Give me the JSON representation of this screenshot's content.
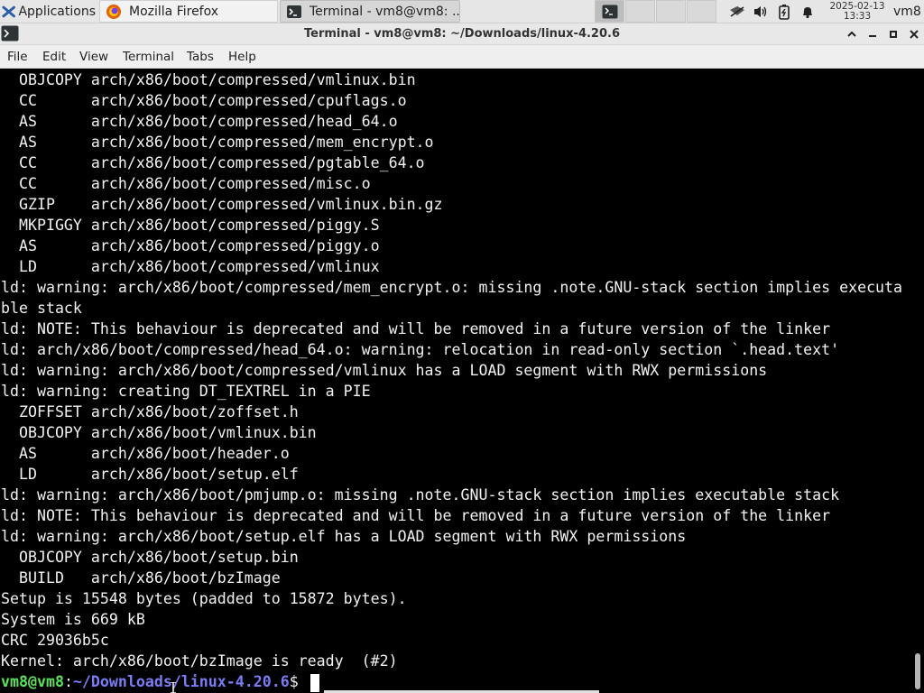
{
  "panel": {
    "applications_label": "Applications",
    "tasks": [
      {
        "label": "Mozilla Firefox",
        "icon": "firefox-icon"
      },
      {
        "label": "Terminal - vm8@vm8: ...",
        "icon": "terminal-icon"
      }
    ],
    "clock_date": "2025-02-13",
    "clock_time": "13:33",
    "user": "vm8"
  },
  "window": {
    "title": "Terminal - vm8@vm8: ~/Downloads/linux-4.20.6"
  },
  "menubar": {
    "file": "File",
    "edit": "Edit",
    "view": "View",
    "terminal": "Terminal",
    "tabs": "Tabs",
    "help": "Help"
  },
  "terminal": {
    "lines": [
      "  OBJCOPY arch/x86/boot/compressed/vmlinux.bin",
      "  CC      arch/x86/boot/compressed/cpuflags.o",
      "  AS      arch/x86/boot/compressed/head_64.o",
      "  AS      arch/x86/boot/compressed/mem_encrypt.o",
      "  CC      arch/x86/boot/compressed/pgtable_64.o",
      "  CC      arch/x86/boot/compressed/misc.o",
      "  GZIP    arch/x86/boot/compressed/vmlinux.bin.gz",
      "  MKPIGGY arch/x86/boot/compressed/piggy.S",
      "  AS      arch/x86/boot/compressed/piggy.o",
      "  LD      arch/x86/boot/compressed/vmlinux",
      "ld: warning: arch/x86/boot/compressed/mem_encrypt.o: missing .note.GNU-stack section implies executa",
      "ble stack",
      "ld: NOTE: This behaviour is deprecated and will be removed in a future version of the linker",
      "ld: arch/x86/boot/compressed/head_64.o: warning: relocation in read-only section `.head.text'",
      "ld: warning: arch/x86/boot/compressed/vmlinux has a LOAD segment with RWX permissions",
      "ld: warning: creating DT_TEXTREL in a PIE",
      "  ZOFFSET arch/x86/boot/zoffset.h",
      "  OBJCOPY arch/x86/boot/vmlinux.bin",
      "  AS      arch/x86/boot/header.o",
      "  LD      arch/x86/boot/setup.elf",
      "ld: warning: arch/x86/boot/pmjump.o: missing .note.GNU-stack section implies executable stack",
      "ld: NOTE: This behaviour is deprecated and will be removed in a future version of the linker",
      "ld: warning: arch/x86/boot/setup.elf has a LOAD segment with RWX permissions",
      "  OBJCOPY arch/x86/boot/setup.bin",
      "  BUILD   arch/x86/boot/bzImage",
      "Setup is 15548 bytes (padded to 15872 bytes).",
      "System is 669 kB",
      "CRC 29036b5c",
      "Kernel: arch/x86/boot/bzImage is ready  (#2)"
    ],
    "prompt_user": "vm8@vm8",
    "prompt_sep": ":",
    "prompt_path": "~/Downloads/linux-4.20.6",
    "prompt_symbol": "$"
  },
  "colors": {
    "prompt_user": "#5be35b",
    "prompt_path": "#7b7cf5",
    "terminal_bg": "#000000",
    "terminal_fg": "#f2f2f2"
  }
}
